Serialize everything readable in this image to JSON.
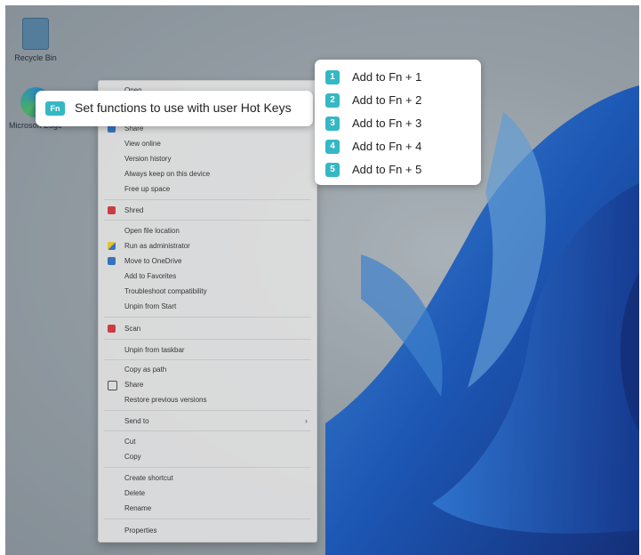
{
  "desktop": {
    "icons": [
      {
        "label": "Recycle Bin"
      },
      {
        "label": "Microsoft Edge"
      }
    ]
  },
  "context_menu": {
    "items": [
      {
        "label": "Open"
      },
      {
        "label": "Share",
        "icon": "onedrive-cloud-icon"
      },
      {
        "label": "View online"
      },
      {
        "label": "Version history"
      },
      {
        "label": "Always keep on this device"
      },
      {
        "label": "Free up space"
      },
      {
        "label": "Shred",
        "icon": "mcafee-icon"
      },
      {
        "label": "Open file location"
      },
      {
        "label": "Run as administrator",
        "icon": "shield-icon"
      },
      {
        "label": "Move to OneDrive",
        "icon": "onedrive-cloud-icon"
      },
      {
        "label": "Add to Favorites"
      },
      {
        "label": "Troubleshoot compatibility"
      },
      {
        "label": "Unpin from Start"
      },
      {
        "label": "Scan",
        "icon": "mcafee-icon"
      },
      {
        "label": "Unpin from taskbar"
      },
      {
        "label": "Copy as path"
      },
      {
        "label": "Share",
        "icon": "share-icon"
      },
      {
        "label": "Restore previous versions"
      },
      {
        "label": "Send to",
        "submenu": "›"
      },
      {
        "label": "Cut"
      },
      {
        "label": "Copy"
      },
      {
        "label": "Create shortcut"
      },
      {
        "label": "Delete"
      },
      {
        "label": "Rename"
      },
      {
        "label": "Properties"
      }
    ]
  },
  "hotkey_callout": {
    "badge": "Fn",
    "text": "Set functions to use with user Hot Keys"
  },
  "fn_submenu": {
    "items": [
      {
        "badge": "1",
        "label": "Add to Fn + 1"
      },
      {
        "badge": "2",
        "label": "Add to Fn + 2"
      },
      {
        "badge": "3",
        "label": "Add to Fn + 3"
      },
      {
        "badge": "4",
        "label": "Add to Fn + 4"
      },
      {
        "badge": "5",
        "label": "Add to Fn + 5"
      }
    ]
  },
  "colors": {
    "badge": "#35b8c4",
    "wallpaper_blue": "#1560d8"
  }
}
